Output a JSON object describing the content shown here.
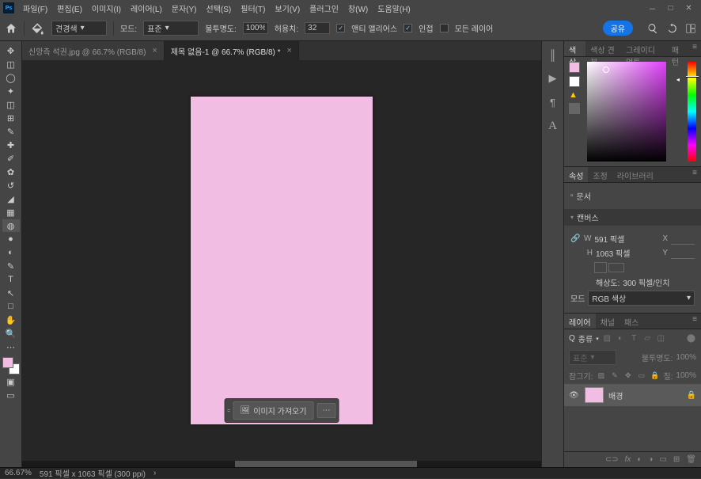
{
  "menu": {
    "items": [
      "파일(F)",
      "편집(E)",
      "이미지(I)",
      "레이어(L)",
      "문자(Y)",
      "선택(S)",
      "필터(T)",
      "보기(V)",
      "플러그인",
      "창(W)",
      "도움말(H)"
    ]
  },
  "options": {
    "dropdown1": "견경색",
    "mode_label": "모드:",
    "mode_value": "표준",
    "opacity_label": "불투명도:",
    "opacity_value": "100%",
    "tolerance_label": "허용치:",
    "tolerance_value": "32",
    "cb1": "앤티 앨리어스",
    "cb2": "인접",
    "cb3": "모든 레이어",
    "share": "공유"
  },
  "tabs": [
    {
      "label": "신앙측 석권.jpg @ 66.7% (RGB/8)",
      "active": false
    },
    {
      "label": "제목 없음-1 @ 66.7% (RGB/8) *",
      "active": true
    }
  ],
  "canvas": {
    "import_btn": "이미지 가져오기"
  },
  "color_panel": {
    "tabs": [
      "색상",
      "색상 견본",
      "그레이디언트",
      "패턴"
    ]
  },
  "props_panel": {
    "tabs": [
      "속성",
      "조정",
      "라이브러리"
    ],
    "doc_label": "문서",
    "section": "캔버스",
    "W": "591 픽셀",
    "H": "1063 픽셀",
    "X": "",
    "Y": "",
    "x_label": "X",
    "y_label": "Y",
    "resolution_label": "해상도:",
    "resolution_value": "300 픽셀/인치",
    "mode_label": "모드",
    "mode_value": "RGB 색상"
  },
  "layers_panel": {
    "tabs": [
      "레이어",
      "채널",
      "패스"
    ],
    "search_label": "종류",
    "blend_mode": "표준",
    "opacity_label": "불투명도:",
    "opacity_value": "100%",
    "lock_label": "잠그기:",
    "fill_label": "칠:",
    "fill_value": "100%",
    "layer_name": "배경"
  },
  "status": {
    "zoom": "66.67%",
    "info": "591 픽셀 x 1063 픽셀 (300 ppi)"
  }
}
